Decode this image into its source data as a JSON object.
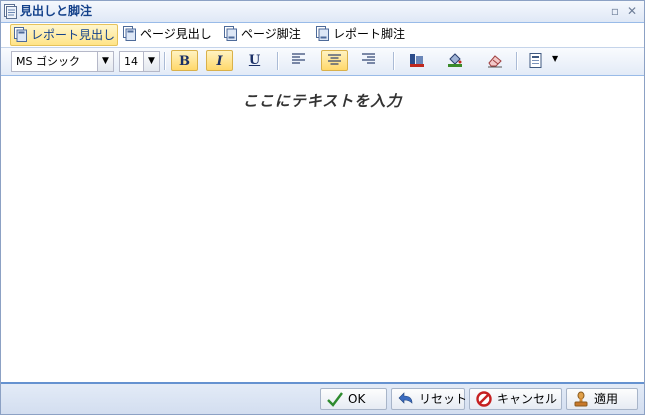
{
  "window": {
    "title": "見出しと脚注",
    "icon": "document-icon"
  },
  "tabs": [
    {
      "label": "レポート見出し",
      "icon": "report-header-icon",
      "active": true
    },
    {
      "label": "ページ見出し",
      "icon": "page-header-icon",
      "active": false
    },
    {
      "label": "ページ脚注",
      "icon": "page-footer-icon",
      "active": false
    },
    {
      "label": "レポート脚注",
      "icon": "report-footer-icon",
      "active": false
    }
  ],
  "toolbar": {
    "font_family": "MS ゴシック",
    "font_size": "14",
    "bold_label": "B",
    "italic_label": "I",
    "underline_label": "U",
    "bold_active": true,
    "italic_active": true,
    "align_active": "center"
  },
  "editor": {
    "placeholder": "ここにテキストを入力"
  },
  "footer": {
    "ok_label": "OK",
    "reset_label": "リセット",
    "cancel_label": "キャンセル",
    "apply_label": "適用"
  },
  "colors": {
    "accent": "#6592d0",
    "title_text": "#15428b",
    "toggle_on": "#ffd86b"
  }
}
